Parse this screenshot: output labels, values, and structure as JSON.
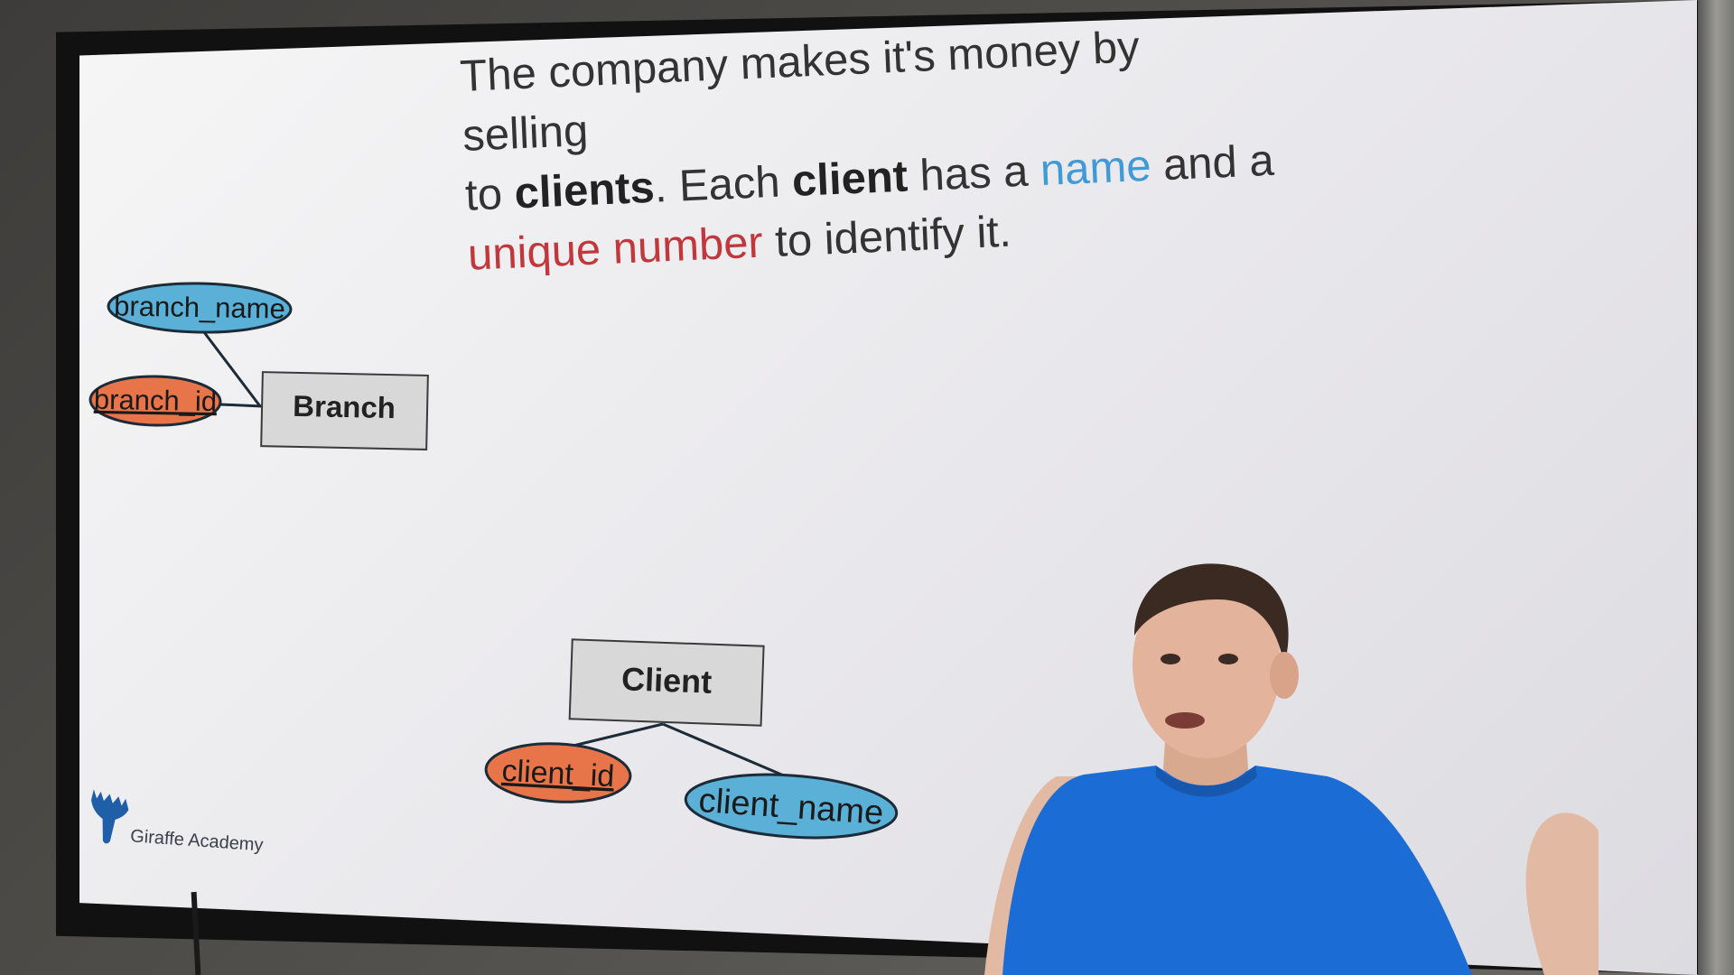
{
  "slide": {
    "sentence": [
      {
        "text": "The company makes it's money by selling",
        "style": "normal"
      },
      {
        "text": "to ",
        "style": "normal"
      },
      {
        "text": "clients",
        "style": "bold"
      },
      {
        "text": ". Each ",
        "style": "normal"
      },
      {
        "text": "client",
        "style": "bold"
      },
      {
        "text": " has a ",
        "style": "normal"
      },
      {
        "text": "name",
        "style": "blue"
      },
      {
        "text": " and a",
        "style": "normal"
      },
      {
        "text": "unique number",
        "style": "red"
      },
      {
        "text": " to identify it.",
        "style": "normal"
      }
    ]
  },
  "diagram": {
    "entities": [
      {
        "id": "branch",
        "label": "Branch"
      },
      {
        "id": "client",
        "label": "Client"
      }
    ],
    "attributes": [
      {
        "id": "branch_name",
        "label": "branch_name",
        "kind": "attribute",
        "entity": "branch"
      },
      {
        "id": "branch_id",
        "label": "branch_id",
        "kind": "primary-key",
        "entity": "branch"
      },
      {
        "id": "client_id",
        "label": "client_id",
        "kind": "primary-key",
        "entity": "client"
      },
      {
        "id": "client_name",
        "label": "client_name",
        "kind": "attribute",
        "entity": "client"
      }
    ],
    "colors": {
      "attribute_fill": "#5ab0d6",
      "primary_key_fill": "#e8744a",
      "entity_fill": "#d8d8d8",
      "outline": "#1c2b38"
    }
  },
  "branding": {
    "logo_text": "Giraffe Academy",
    "logo_icon": "giraffe-icon",
    "logo_color": "#1f5fa8"
  }
}
